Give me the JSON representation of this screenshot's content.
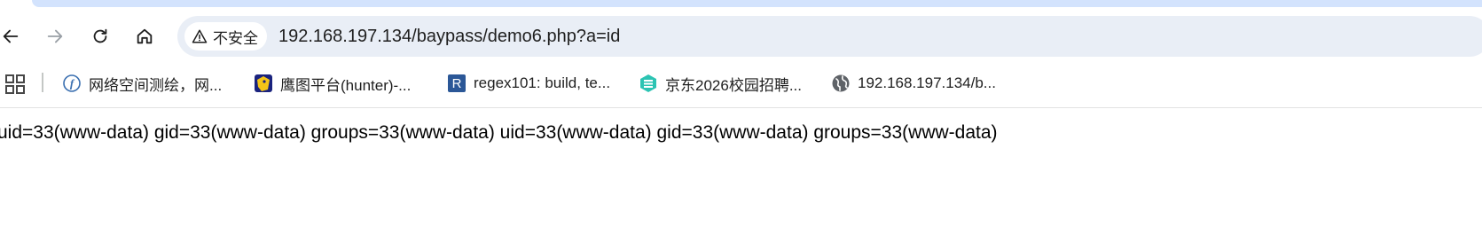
{
  "browser": {
    "security_label": "不安全",
    "url": "192.168.197.134/baypass/demo6.php?a=id"
  },
  "bookmarks": [
    {
      "label": "网络空间测绘，网...",
      "icon": "fofa-icon"
    },
    {
      "label": "鹰图平台(hunter)-...",
      "icon": "hunter-icon"
    },
    {
      "label": "regex101: build, te...",
      "icon": "regex101-icon"
    },
    {
      "label": "京东2026校园招聘...",
      "icon": "jd-icon"
    },
    {
      "label": "192.168.197.134/b...",
      "icon": "globe-icon"
    }
  ],
  "page": {
    "output": "uid=33(www-data) gid=33(www-data) groups=33(www-data) uid=33(www-data) gid=33(www-data) groups=33(www-data)"
  },
  "colors": {
    "omnibox_bg": "#e9eef6",
    "tab_accent": "#d3e3fd",
    "regex_blue": "#2b5797",
    "jd_teal": "#2cc4b3"
  }
}
